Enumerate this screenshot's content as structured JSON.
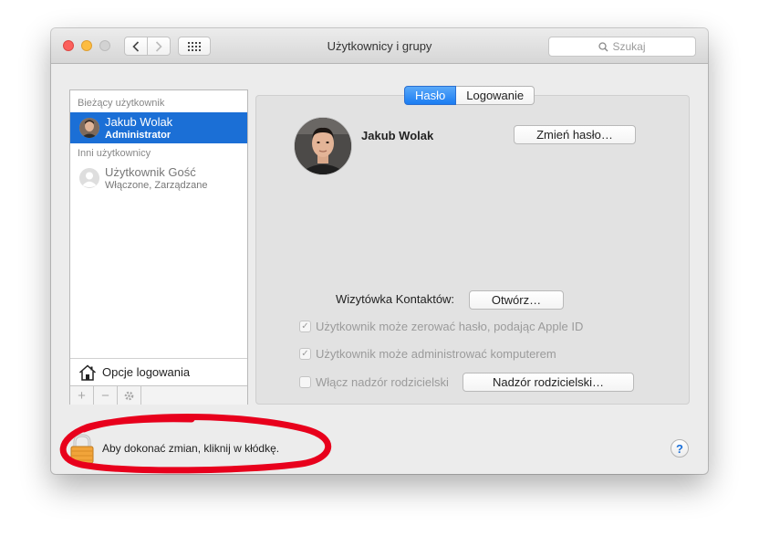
{
  "window": {
    "title": "Użytkownicy i grupy"
  },
  "search": {
    "placeholder": "Szukaj"
  },
  "sidebar": {
    "current_header": "Bieżący użytkownik",
    "current_user": {
      "name": "Jakub Wolak",
      "role": "Administrator"
    },
    "others_header": "Inni użytkownicy",
    "guest_user": {
      "name": "Użytkownik Gość",
      "status": "Włączone, Zarządzane"
    },
    "login_options": "Opcje logowania"
  },
  "tabs": {
    "password": "Hasło",
    "login": "Logowanie",
    "active": "password"
  },
  "profile": {
    "name": "Jakub Wolak",
    "change_password": "Zmień hasło…"
  },
  "contacts": {
    "label": "Wizytówka Kontaktów:",
    "open": "Otwórz…"
  },
  "options": {
    "reset_password": {
      "label": "Użytkownik może zerować hasło, podając Apple ID",
      "checked": true
    },
    "administer": {
      "label": "Użytkownik może administrować komputerem",
      "checked": true
    },
    "parental": {
      "label": "Włącz nadzór rodzicielski",
      "checked": false
    },
    "parental_button": "Nadzór rodzicielski…"
  },
  "footer": {
    "lock_text": "Aby dokonać zmian, kliknij w kłódkę.",
    "help": "?"
  },
  "colors": {
    "selection": "#1b6fd6",
    "tab_active": "#1a7cf2",
    "annotation": "#e8001c"
  }
}
